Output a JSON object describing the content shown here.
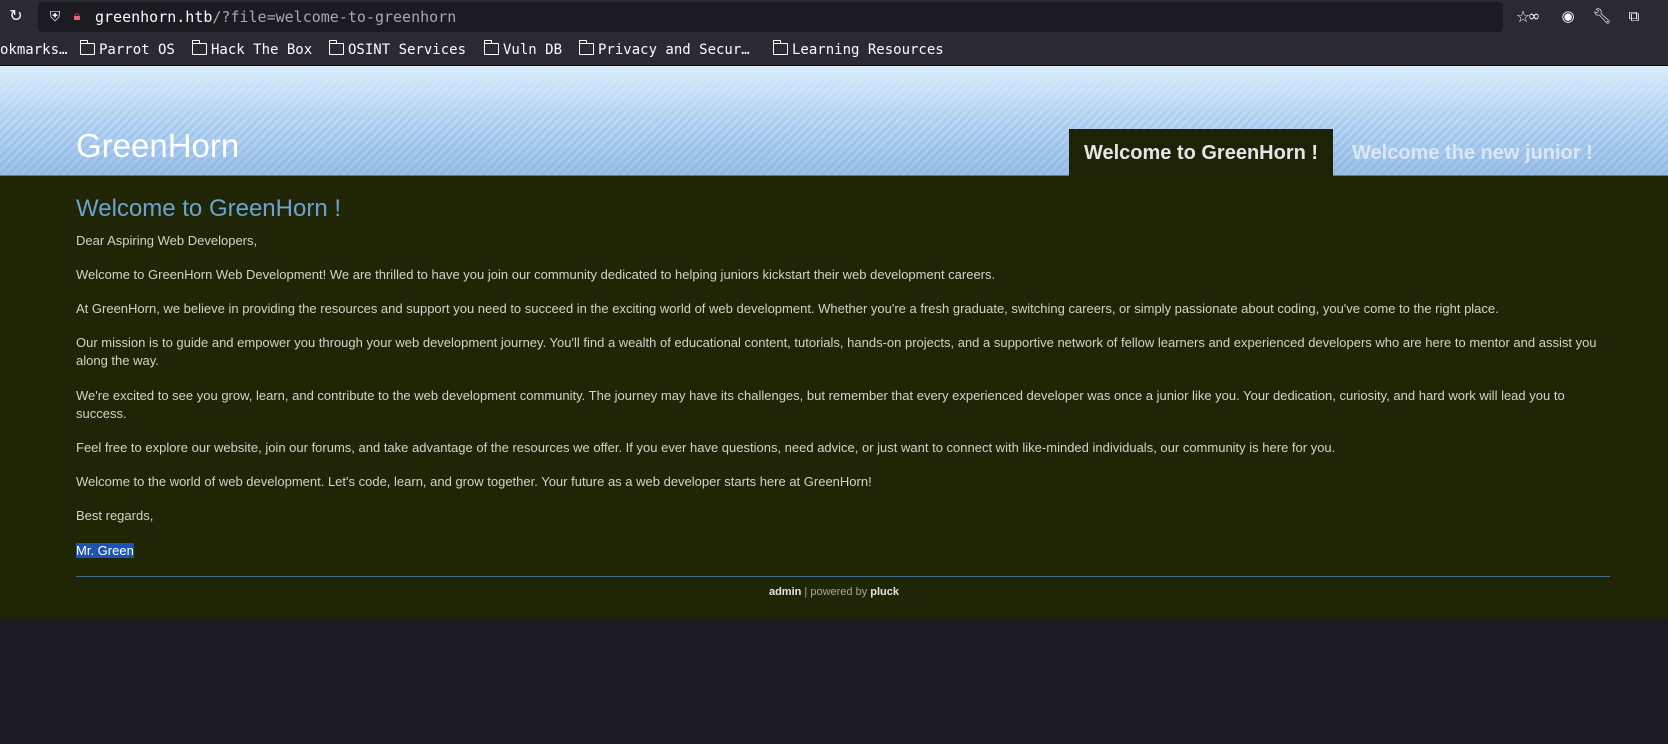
{
  "browser": {
    "url_host": "greenhorn.htb",
    "url_path": "/?file=welcome-to-greenhorn",
    "icons": [
      "reload-icon",
      "shield-icon",
      "lock-icon",
      "star-icon",
      "mask-icon",
      "account-icon",
      "wrench-icon",
      "extensions-icon"
    ]
  },
  "bookmarks": [
    {
      "label": "okmarks…",
      "folder": false
    },
    {
      "label": "Parrot OS",
      "folder": true
    },
    {
      "label": "Hack The Box",
      "folder": true
    },
    {
      "label": "OSINT Services",
      "folder": true
    },
    {
      "label": "Vuln DB",
      "folder": true
    },
    {
      "label": "Privacy and Secur…",
      "folder": true
    },
    {
      "label": "Learning Resources",
      "folder": true
    }
  ],
  "site": {
    "title": "GreenHorn",
    "nav": [
      {
        "label": "Welcome to GreenHorn !",
        "active": true
      },
      {
        "label": "Welcome the new junior !",
        "active": false
      }
    ]
  },
  "article": {
    "heading": "Welcome to GreenHorn !",
    "paragraphs": [
      "Dear Aspiring Web Developers,",
      "Welcome to GreenHorn Web Development! We are thrilled to have you join our community dedicated to helping juniors kickstart their web development careers.",
      "At GreenHorn, we believe in providing the resources and support you need to succeed in the exciting world of web development. Whether you're a fresh graduate, switching careers, or simply passionate about coding, you've come to the right place.",
      "Our mission is to guide and empower you through your web development journey. You'll find a wealth of educational content, tutorials, hands-on projects, and a supportive network of fellow learners and experienced developers who are here to mentor and assist you along the way.",
      "We're excited to see you grow, learn, and contribute to the web development community. The journey may have its challenges, but remember that every experienced developer was once a junior like you. Your dedication, curiosity, and hard work will lead you to success.",
      "Feel free to explore our website, join our forums, and take advantage of the resources we offer. If you ever have questions, need advice, or just want to connect with like-minded individuals, our community is here for you.",
      "Welcome to the world of web development. Let's code, learn, and grow together. Your future as a web developer starts here at GreenHorn!",
      "Best regards,"
    ],
    "signature": "Mr. Green"
  },
  "footer": {
    "admin_link": "admin",
    "separator_text": " | powered by ",
    "pluck_link": "pluck"
  },
  "colors": {
    "browser_chrome": "#2b2a33",
    "content_bg": "#202506",
    "heading": "#6aa3d2",
    "selection": "#1b54b5"
  }
}
